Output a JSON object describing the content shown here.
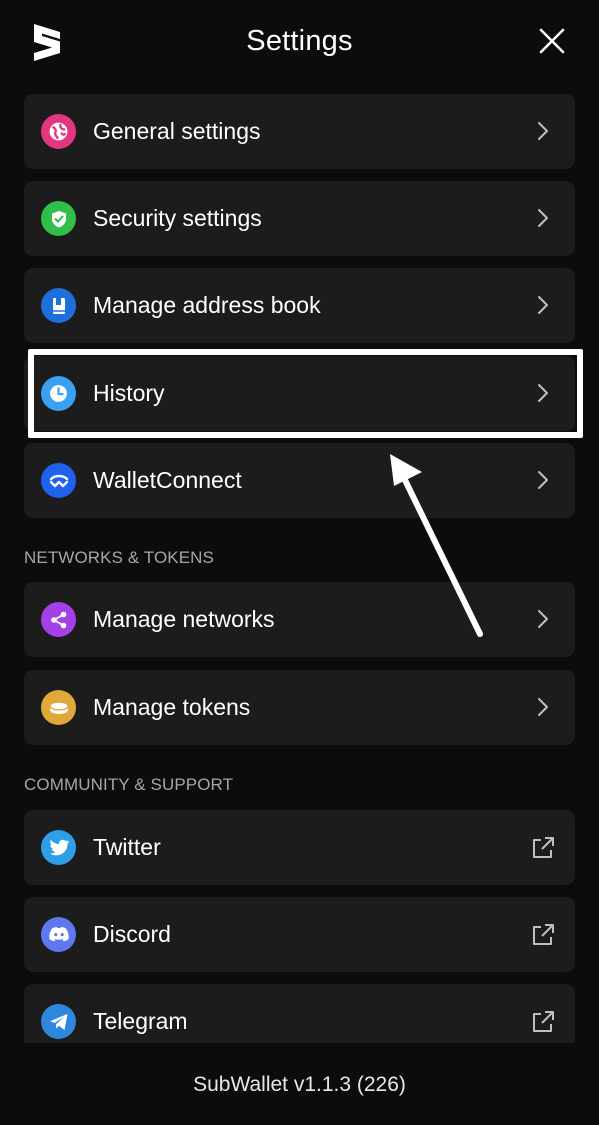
{
  "header": {
    "title": "Settings",
    "logo_icon": "subwallet-logo-icon",
    "close_icon": "close-icon"
  },
  "general_items": [
    {
      "label": "General settings",
      "icon": "globe-icon",
      "color": "#e0377e",
      "trailing": "chevron-right-icon"
    },
    {
      "label": "Security settings",
      "icon": "shield-check-icon",
      "color": "#2fbf4a",
      "trailing": "chevron-right-icon"
    },
    {
      "label": "Manage address book",
      "icon": "book-icon",
      "color": "#1e6fd9",
      "trailing": "chevron-right-icon"
    },
    {
      "label": "History",
      "icon": "clock-icon",
      "color": "#3aa0ef",
      "trailing": "chevron-right-icon"
    },
    {
      "label": "WalletConnect",
      "icon": "walletconnect-icon",
      "color": "#1f62f1",
      "trailing": "chevron-right-icon"
    }
  ],
  "networks_section": {
    "heading": "NETWORKS & TOKENS",
    "items": [
      {
        "label": "Manage networks",
        "icon": "share-nodes-icon",
        "color": "#a340e6",
        "trailing": "chevron-right-icon"
      },
      {
        "label": "Manage tokens",
        "icon": "coin-icon",
        "color": "#e0a93c",
        "trailing": "chevron-right-icon"
      }
    ]
  },
  "community_section": {
    "heading": "COMMUNITY & SUPPORT",
    "items": [
      {
        "label": "Twitter",
        "icon": "twitter-icon",
        "color": "#2f9ee9",
        "trailing": "external-link-icon"
      },
      {
        "label": "Discord",
        "icon": "discord-icon",
        "color": "#5f78f0",
        "trailing": "external-link-icon"
      },
      {
        "label": "Telegram",
        "icon": "telegram-icon",
        "color": "#2f87dd",
        "trailing": "external-link-icon"
      }
    ]
  },
  "footer": {
    "version": "SubWallet v1.1.3 (226)"
  },
  "annotation": {
    "highlight_color": "#ffffff",
    "highlighted_item": "History"
  }
}
